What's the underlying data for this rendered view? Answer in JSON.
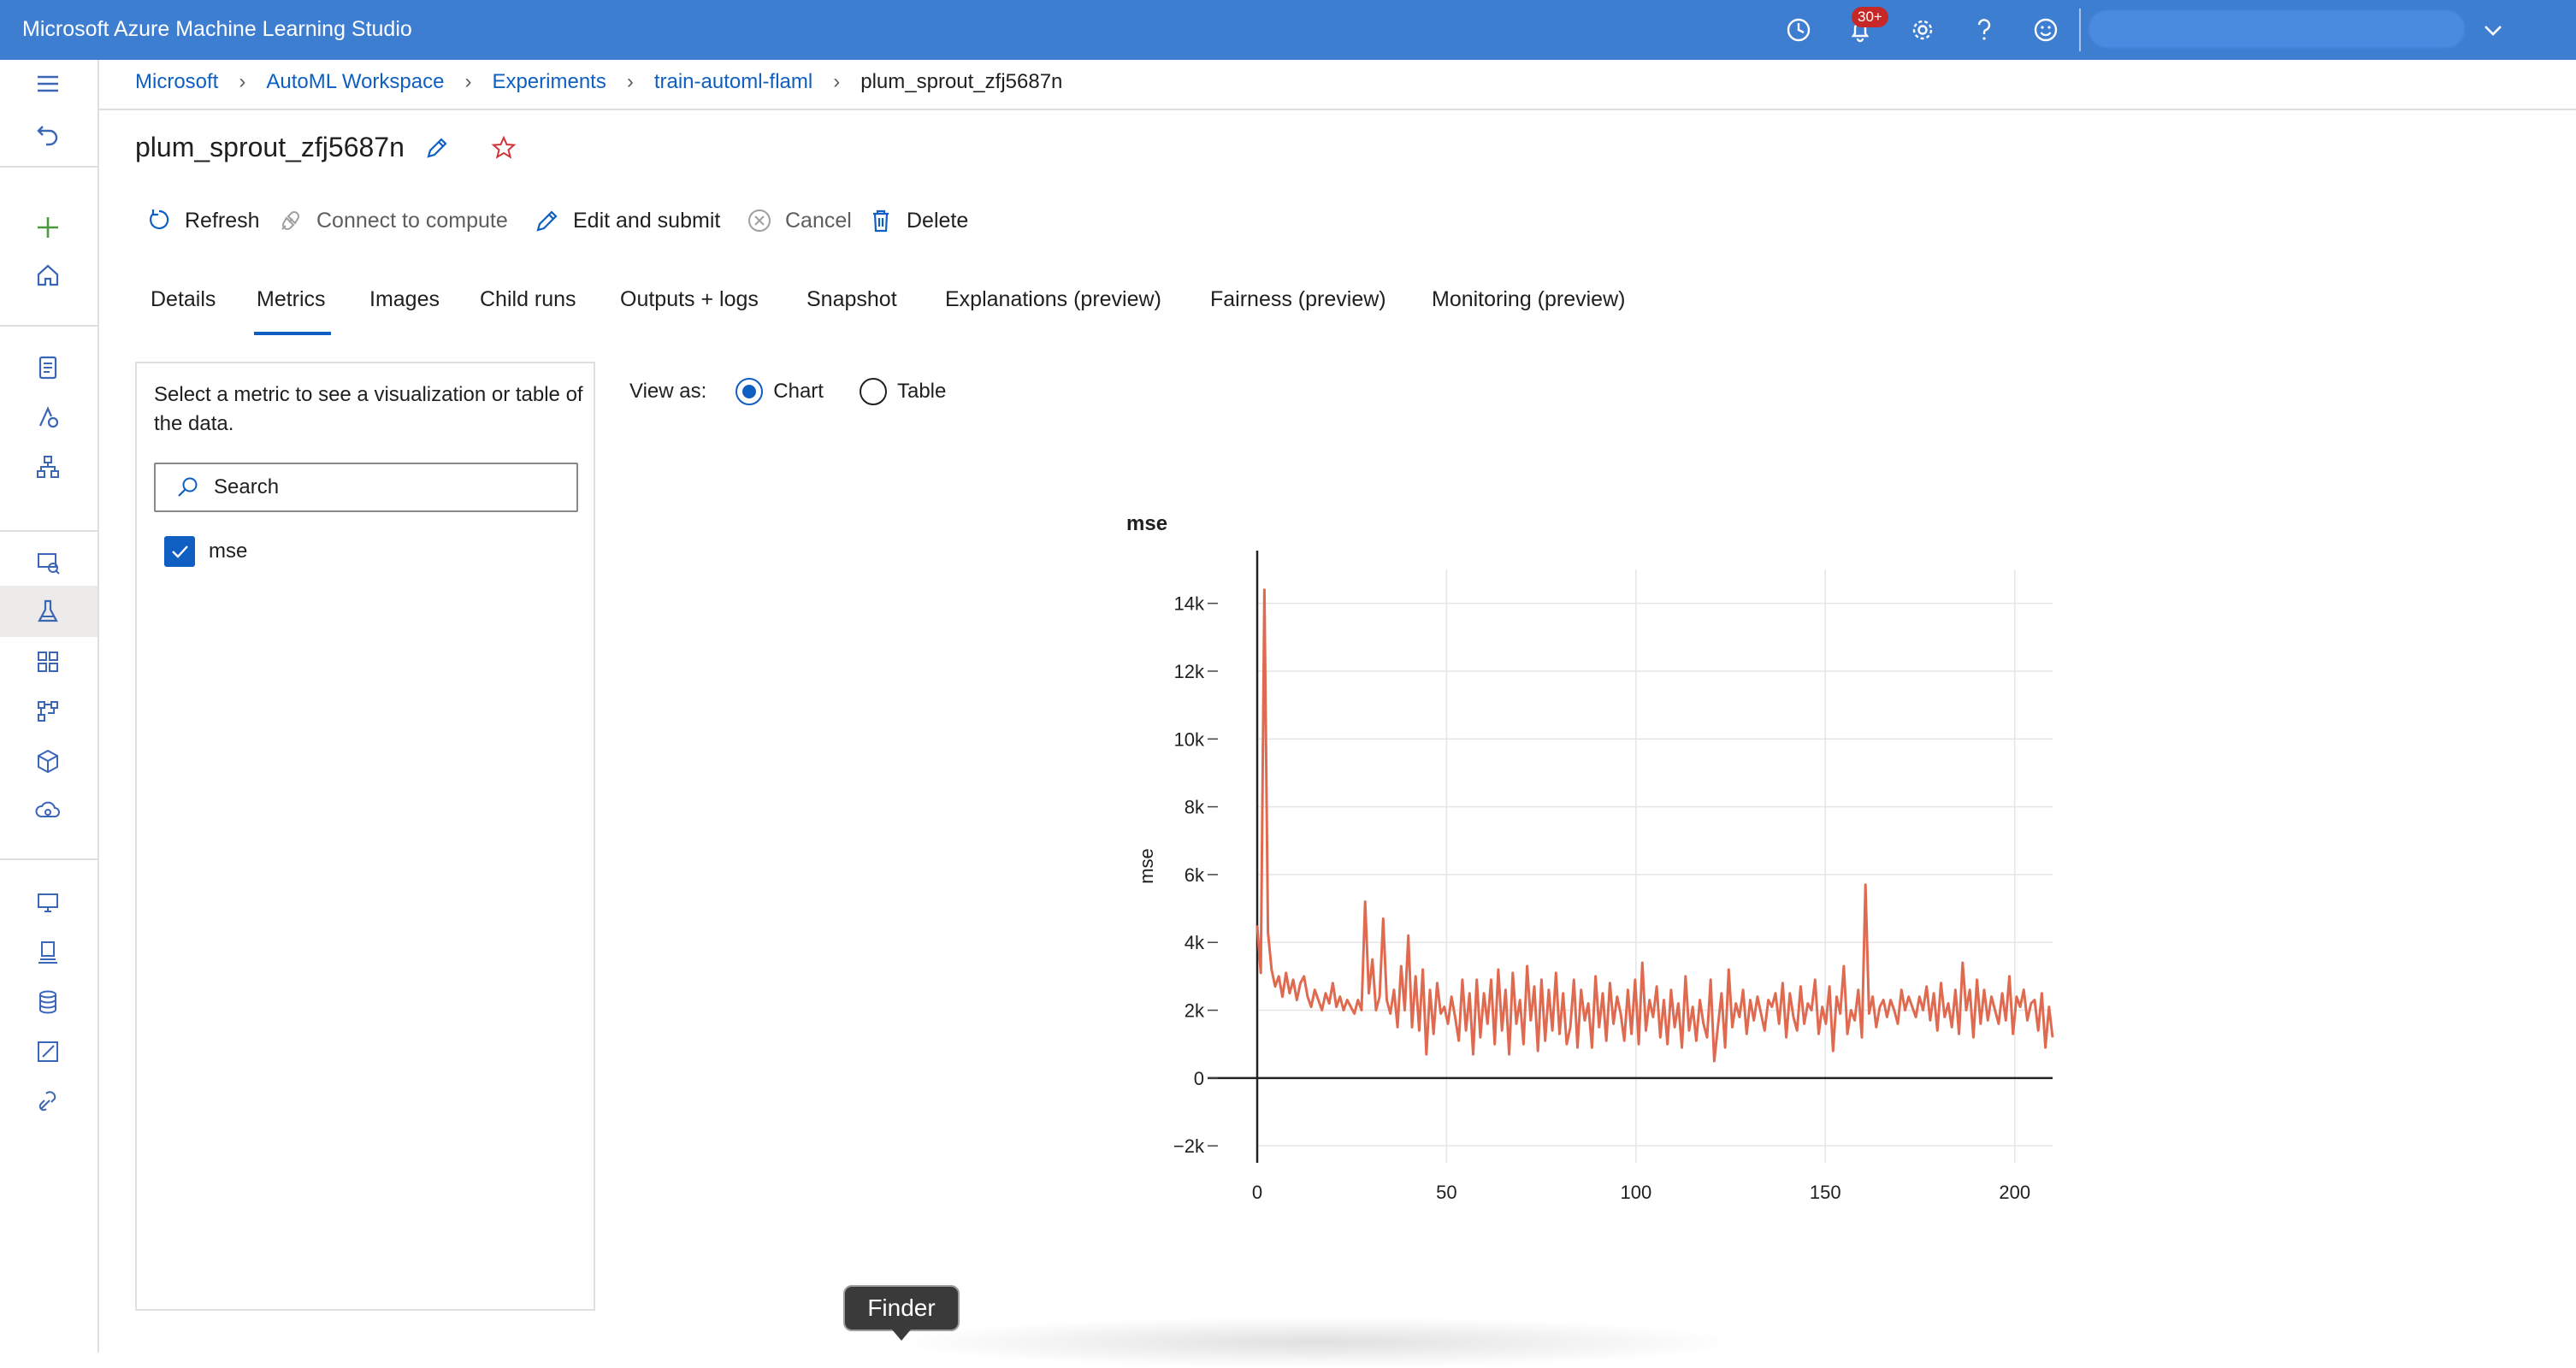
{
  "topbar": {
    "title": "Microsoft Azure Machine Learning Studio",
    "notification_count": "30+",
    "icons": [
      "history-icon",
      "bell-icon",
      "gear-icon",
      "help-icon",
      "smiley-icon",
      "chevron-down-icon"
    ],
    "color": "#3d7ed1"
  },
  "breadcrumb": {
    "items": [
      "Microsoft",
      "AutoML Workspace",
      "Experiments",
      "train-automl-flaml"
    ],
    "current": "plum_sprout_zfj5687n"
  },
  "page": {
    "title": "plum_sprout_zfj5687n"
  },
  "commands": {
    "refresh": "Refresh",
    "connect": "Connect to compute",
    "edit_submit": "Edit and submit",
    "cancel": "Cancel",
    "delete": "Delete"
  },
  "tabs": [
    "Details",
    "Metrics",
    "Images",
    "Child runs",
    "Outputs + logs",
    "Snapshot",
    "Explanations (preview)",
    "Fairness (preview)",
    "Monitoring (preview)"
  ],
  "active_tab": "Metrics",
  "metric_panel": {
    "description": "Select a metric to see a visualization or table of the data.",
    "search_placeholder": "Search",
    "metrics": [
      {
        "label": "mse",
        "checked": true
      }
    ]
  },
  "view_as": {
    "label": "View as:",
    "options": [
      "Chart",
      "Table"
    ],
    "selected": "Chart"
  },
  "chart_data": {
    "type": "line",
    "title": "mse",
    "ylabel": "mse",
    "xlabel": "",
    "xlim": [
      0,
      210
    ],
    "ylim": [
      -2500,
      15000
    ],
    "x_ticks": [
      0,
      50,
      100,
      150,
      200
    ],
    "y_ticks": [
      -2000,
      0,
      2000,
      4000,
      6000,
      8000,
      10000,
      12000,
      14000
    ],
    "y_tick_labels": [
      "−2k",
      "0",
      "2k",
      "4k",
      "6k",
      "8k",
      "10k",
      "12k",
      "14k"
    ],
    "x_tick_labels": [
      "0",
      "50",
      "100",
      "150",
      "200"
    ],
    "grid": true,
    "line_color": "#e06a50",
    "series": [
      {
        "values": [
          4500,
          3100,
          14400,
          4300,
          3200,
          2700,
          3000,
          2400,
          3100,
          2500,
          2900,
          2300,
          2800,
          3000,
          2400,
          2100,
          2600,
          2300,
          2000,
          2500,
          2200,
          2800,
          2100,
          2400,
          2000,
          2300,
          2100,
          1900,
          2300,
          2000,
          5200,
          2500,
          3500,
          2000,
          2400,
          4700,
          2300,
          1900,
          2600,
          1500,
          3300,
          2000,
          4200,
          1500,
          3000,
          1400,
          3200,
          700,
          2600,
          1300,
          2800,
          1900,
          2100,
          1600,
          2400,
          1800,
          1100,
          2900,
          1400,
          2500,
          700,
          2900,
          1200,
          2500,
          1600,
          2900,
          1000,
          3200,
          1400,
          2600,
          700,
          3100,
          1600,
          2300,
          1000,
          3300,
          1700,
          2700,
          800,
          2900,
          1100,
          2600,
          1400,
          3100,
          1300,
          2500,
          1000,
          1500,
          2900,
          900,
          2600,
          1700,
          2200,
          900,
          3000,
          1500,
          2500,
          1100,
          2800,
          1600,
          2400,
          1900,
          1100,
          2600,
          1300,
          2900,
          1000,
          3400,
          1400,
          2300,
          1800,
          2700,
          1200,
          2300,
          1000,
          2600,
          1500,
          2200,
          900,
          3000,
          1400,
          2100,
          1100,
          2300,
          1600,
          1200,
          2900,
          500,
          1500,
          2500,
          900,
          3200,
          1500,
          2200,
          1800,
          2600,
          1300,
          2300,
          1700,
          2400,
          1900,
          1400,
          2300,
          2100,
          2500,
          1600,
          2800,
          1200,
          2500,
          1800,
          1400,
          2700,
          1600,
          2200,
          2000,
          2900,
          1300,
          2100,
          1600,
          2700,
          800,
          2400,
          1900,
          3300,
          1300,
          2000,
          1700,
          2600,
          1200,
          5700,
          1900,
          2400,
          1500,
          2100,
          2300,
          1800,
          2300,
          2000,
          1600,
          2600,
          2000,
          2400,
          2100,
          1800,
          2400,
          2000,
          2700,
          1700,
          2500,
          1400,
          2800,
          1800,
          2200,
          1500,
          2600,
          1300,
          3400,
          2000,
          2600,
          1200,
          2900,
          1600,
          2600,
          1700,
          2400,
          2000,
          1600,
          2500,
          1700,
          3000,
          1300,
          2400,
          2100,
          2600,
          1700,
          2200,
          2300,
          1400,
          2500,
          900,
          2100,
          1200
        ]
      }
    ]
  },
  "tooltip": {
    "finder": "Finder"
  }
}
